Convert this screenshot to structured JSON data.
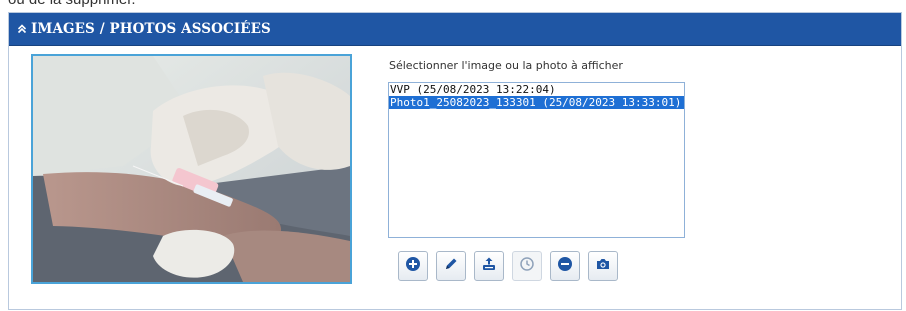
{
  "top_fragment": "ou de la supprimer.",
  "panel": {
    "title": "IMAGES / PHOTOS ASSOCIÉES",
    "collapse_icon": "double-chevron-up-icon"
  },
  "selector": {
    "label": "Sélectionner l'image ou la photo à afficher",
    "items": [
      {
        "label": "VVP (25/08/2023 13:22:04)",
        "selected": false
      },
      {
        "label": "Photo1_25082023_133301 (25/08/2023 13:33:01)",
        "selected": true
      }
    ]
  },
  "toolbar": {
    "buttons": [
      {
        "name": "add-button",
        "icon": "plus-circle-icon",
        "enabled": true
      },
      {
        "name": "edit-button",
        "icon": "pencil-icon",
        "enabled": true
      },
      {
        "name": "upload-button",
        "icon": "upload-icon",
        "enabled": true
      },
      {
        "name": "timer-button",
        "icon": "clock-icon",
        "enabled": false
      },
      {
        "name": "remove-button",
        "icon": "minus-circle-icon",
        "enabled": true
      },
      {
        "name": "camera-button",
        "icon": "camera-icon",
        "enabled": true
      }
    ]
  },
  "colors": {
    "header_bg": "#1f56a4",
    "selection": "#1e6fd4",
    "icon": "#1f56a4"
  }
}
